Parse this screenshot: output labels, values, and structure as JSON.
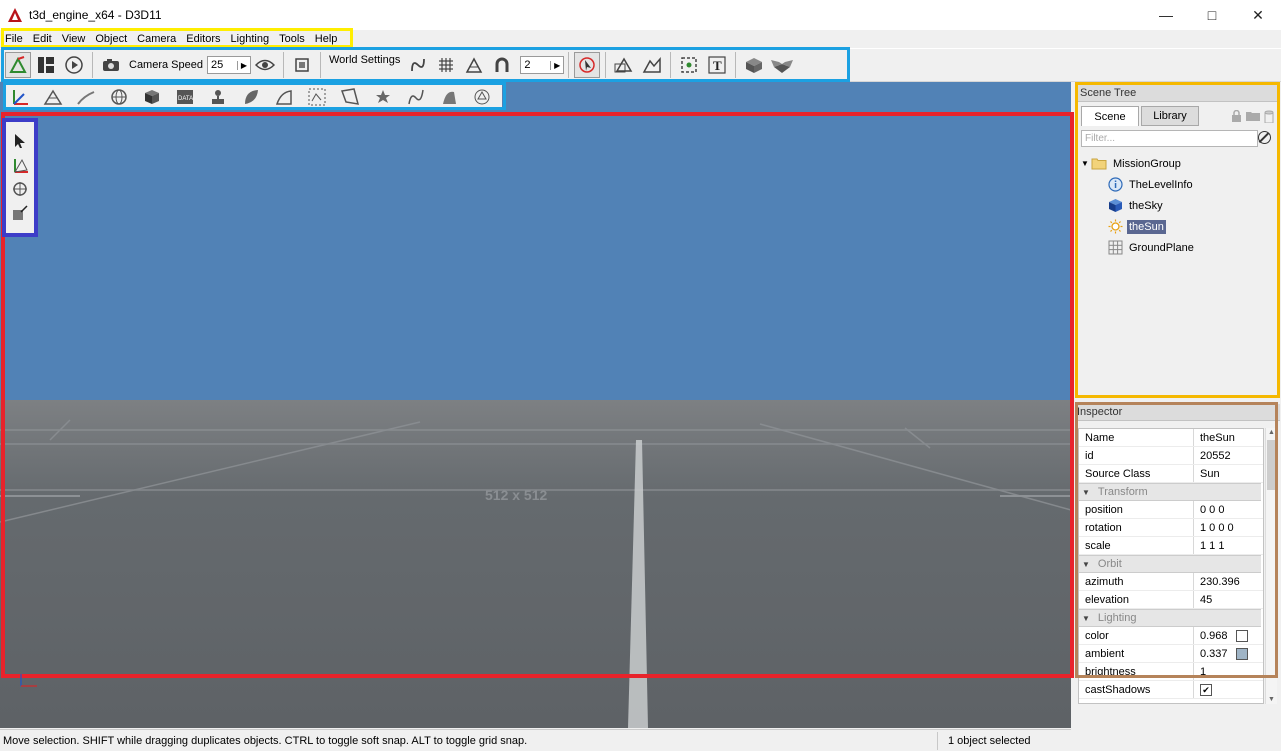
{
  "window": {
    "title": "t3d_engine_x64 - D3D11",
    "controls": [
      "minimize",
      "maximize",
      "close"
    ]
  },
  "menu": {
    "items": [
      "File",
      "Edit",
      "View",
      "Object",
      "Camera",
      "Editors",
      "Lighting",
      "Tools",
      "Help"
    ]
  },
  "toolbar": {
    "camera_speed_label": "Camera Speed",
    "camera_speed_value": "25",
    "world_settings_label": "World Settings",
    "snap_value": "2"
  },
  "scene_tree": {
    "header": "Scene Tree",
    "tabs": [
      "Scene",
      "Library"
    ],
    "filter_placeholder": "Filter...",
    "root": "MissionGroup",
    "children": [
      "TheLevelInfo",
      "theSky",
      "theSun",
      "GroundPlane"
    ],
    "selected": "theSun"
  },
  "inspector": {
    "header": "Inspector",
    "rows_top": [
      {
        "key": "Name",
        "value": "theSun"
      },
      {
        "key": "id",
        "value": "20552"
      },
      {
        "key": "Source Class",
        "value": "Sun"
      }
    ],
    "group_transform": "Transform",
    "rows_transform": [
      {
        "key": "position",
        "value": "0 0 0"
      },
      {
        "key": "rotation",
        "value": "1 0 0 0"
      },
      {
        "key": "scale",
        "value": "1 1 1"
      }
    ],
    "group_orbit": "Orbit",
    "rows_orbit": [
      {
        "key": "azimuth",
        "value": "230.396"
      },
      {
        "key": "elevation",
        "value": "45"
      }
    ],
    "group_lighting": "Lighting",
    "rows_lighting": [
      {
        "key": "color",
        "value": "0.968",
        "swatch": "#ffffff"
      },
      {
        "key": "ambient",
        "value": "0.337",
        "swatch": "#9fb4c6"
      },
      {
        "key": "brightness",
        "value": "1"
      },
      {
        "key": "castShadows",
        "value": "✔"
      }
    ]
  },
  "viewport": {
    "ground_label": "512 x 512",
    "sky_color": "#5182b6",
    "ground_color": "#656a6e"
  },
  "statusbar": {
    "message": "Move selection.  SHIFT while dragging duplicates objects.  CTRL to toggle soft snap.  ALT to toggle grid snap.",
    "selection_count": "1 object selected"
  }
}
